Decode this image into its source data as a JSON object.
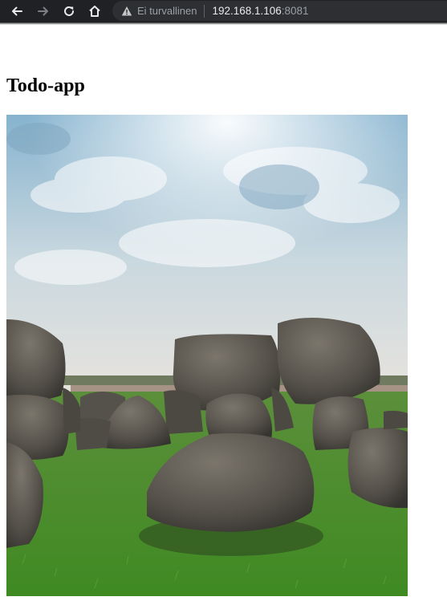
{
  "browser": {
    "security_label": "Ei turvallinen",
    "url_host": "192.168.1.106",
    "url_port": ":8081",
    "icons": [
      "back-arrow-icon",
      "forward-arrow-icon",
      "reload-icon",
      "home-icon",
      "warning-icon"
    ]
  },
  "page": {
    "title": "Todo-app"
  },
  "image": {
    "subject": "photo",
    "colors": {
      "sky_top": "#8fb6cf",
      "sky_mid": "#d9e1e4",
      "sky_horizon": "#efe4d9",
      "grass": "#4f8f2f",
      "stone": "#5a5750"
    }
  }
}
